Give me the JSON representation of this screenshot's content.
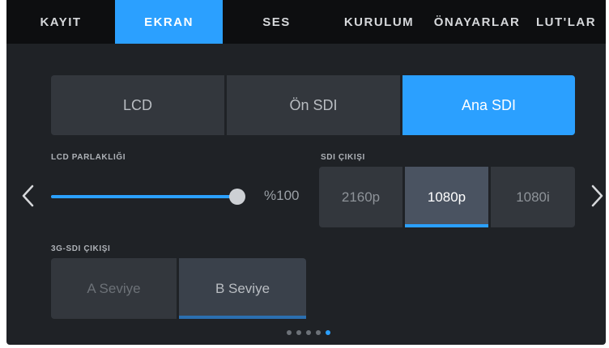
{
  "tabs": [
    {
      "label": "KAYIT",
      "active": false
    },
    {
      "label": "EKRAN",
      "active": true
    },
    {
      "label": "SES",
      "active": false
    },
    {
      "label": "KURULUM",
      "active": false
    },
    {
      "label": "ÖNAYARLAR",
      "active": false
    },
    {
      "label": "LUT'LAR",
      "active": false
    }
  ],
  "monitor_selector": {
    "options": [
      "LCD",
      "Ön SDI",
      "Ana SDI"
    ],
    "selected": "Ana SDI"
  },
  "lcd_brightness": {
    "label": "LCD PARLAKLIĞI",
    "value_text": "%100",
    "value_percent": 100
  },
  "sdi_output": {
    "label": "SDI ÇIKIŞI",
    "options": [
      "2160p",
      "1080p",
      "1080i"
    ],
    "selected": "1080p"
  },
  "sdi_3g_output": {
    "label": "3G-SDI ÇIKIŞI",
    "options": [
      "A Seviye",
      "B Seviye"
    ],
    "selected": "B Seviye"
  },
  "navigation": {
    "prev_icon": "chevron-left-icon",
    "next_icon": "chevron-right-icon"
  },
  "pagination": {
    "total": 5,
    "current": 5
  },
  "colors": {
    "accent": "#2ba0ff",
    "background": "#1f2226",
    "tab_bar": "#0d0e10",
    "control": "#33373d",
    "selected_control": "#4a5361"
  }
}
